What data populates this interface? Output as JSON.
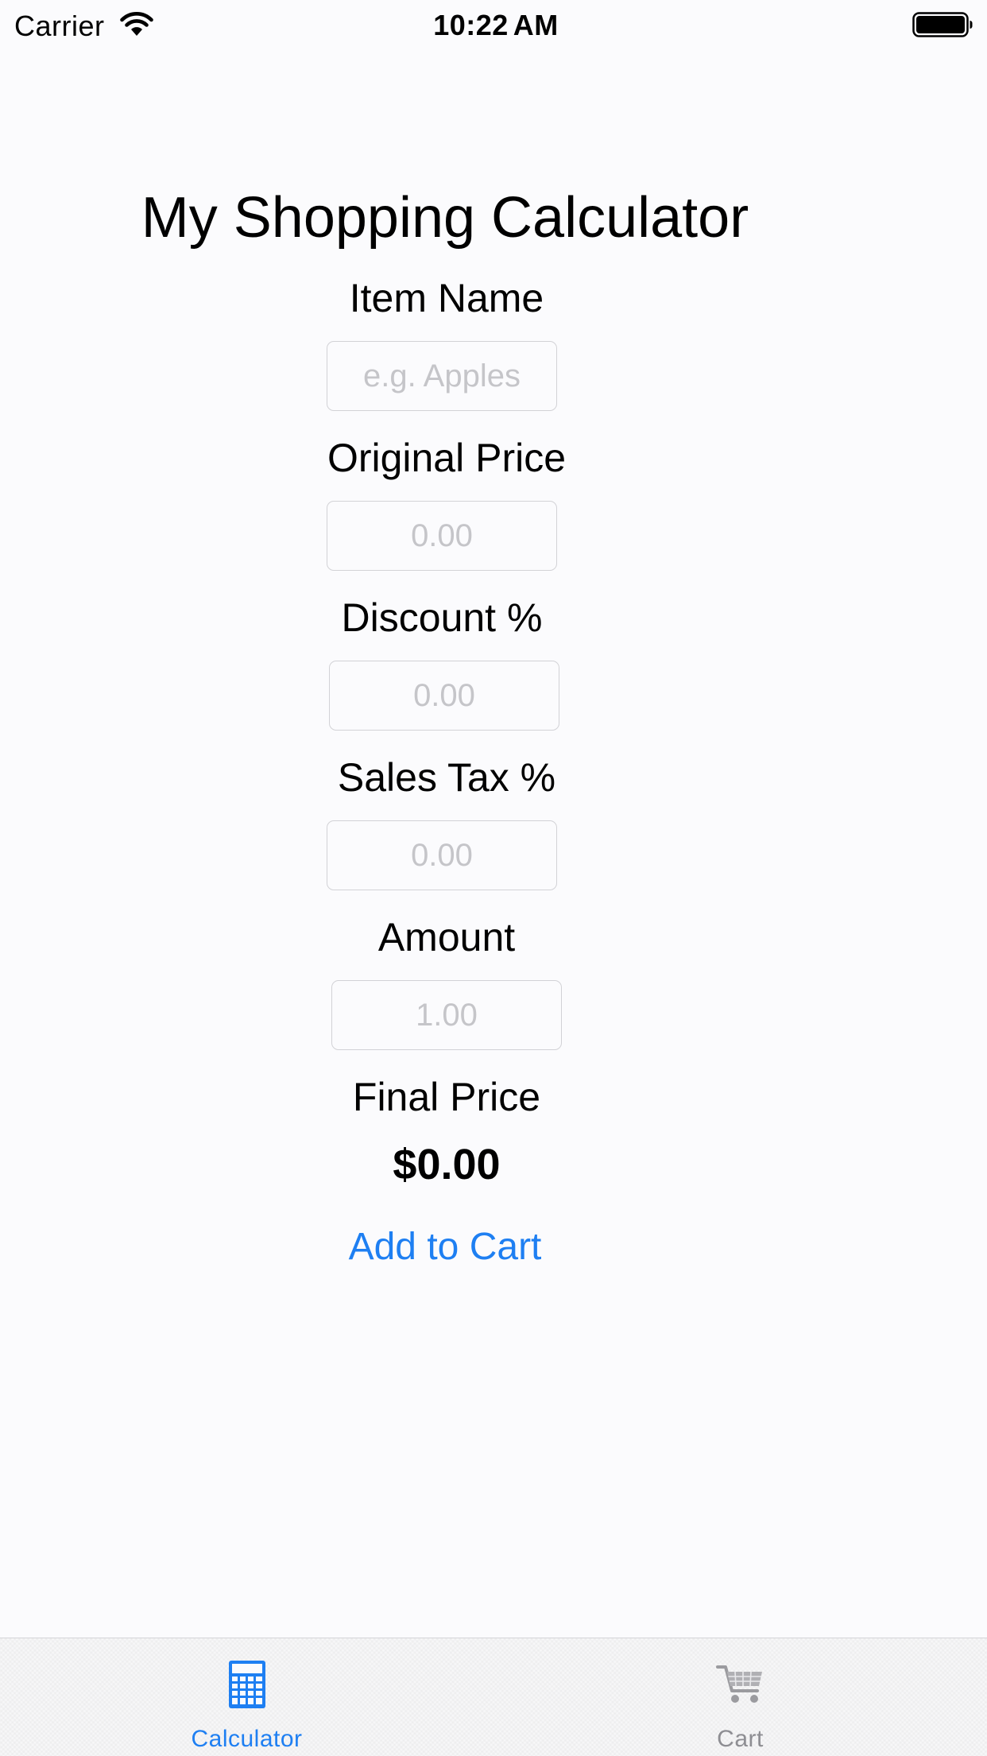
{
  "status_bar": {
    "carrier": "Carrier",
    "time": "10:22",
    "time_suffix": "AM",
    "wifi_icon": "wifi-icon",
    "battery_icon": "battery-full-icon"
  },
  "form": {
    "title": "My Shopping Calculator",
    "item_name": {
      "label": "Item Name",
      "value": "",
      "placeholder": "e.g. Apples"
    },
    "original_price": {
      "label": "Original Price",
      "value": "",
      "placeholder": "0.00"
    },
    "discount": {
      "label": "Discount %",
      "value": "",
      "placeholder": "0.00"
    },
    "sales_tax": {
      "label": "Sales Tax %",
      "value": "",
      "placeholder": "0.00"
    },
    "amount": {
      "label": "Amount",
      "value": "",
      "placeholder": "1.00"
    },
    "final_price": {
      "label": "Final Price",
      "value": "$0.00"
    },
    "add_to_cart_label": "Add to Cart"
  },
  "tab_bar": {
    "tabs": [
      {
        "label": "Calculator",
        "icon": "calculator-icon",
        "selected": true
      },
      {
        "label": "Cart",
        "icon": "cart-icon",
        "selected": false
      }
    ]
  },
  "colors": {
    "accent": "#1e7ff2",
    "inactive_tab": "#8e8e93",
    "placeholder": "#c5c5c9",
    "background": "#fbfbfd"
  }
}
